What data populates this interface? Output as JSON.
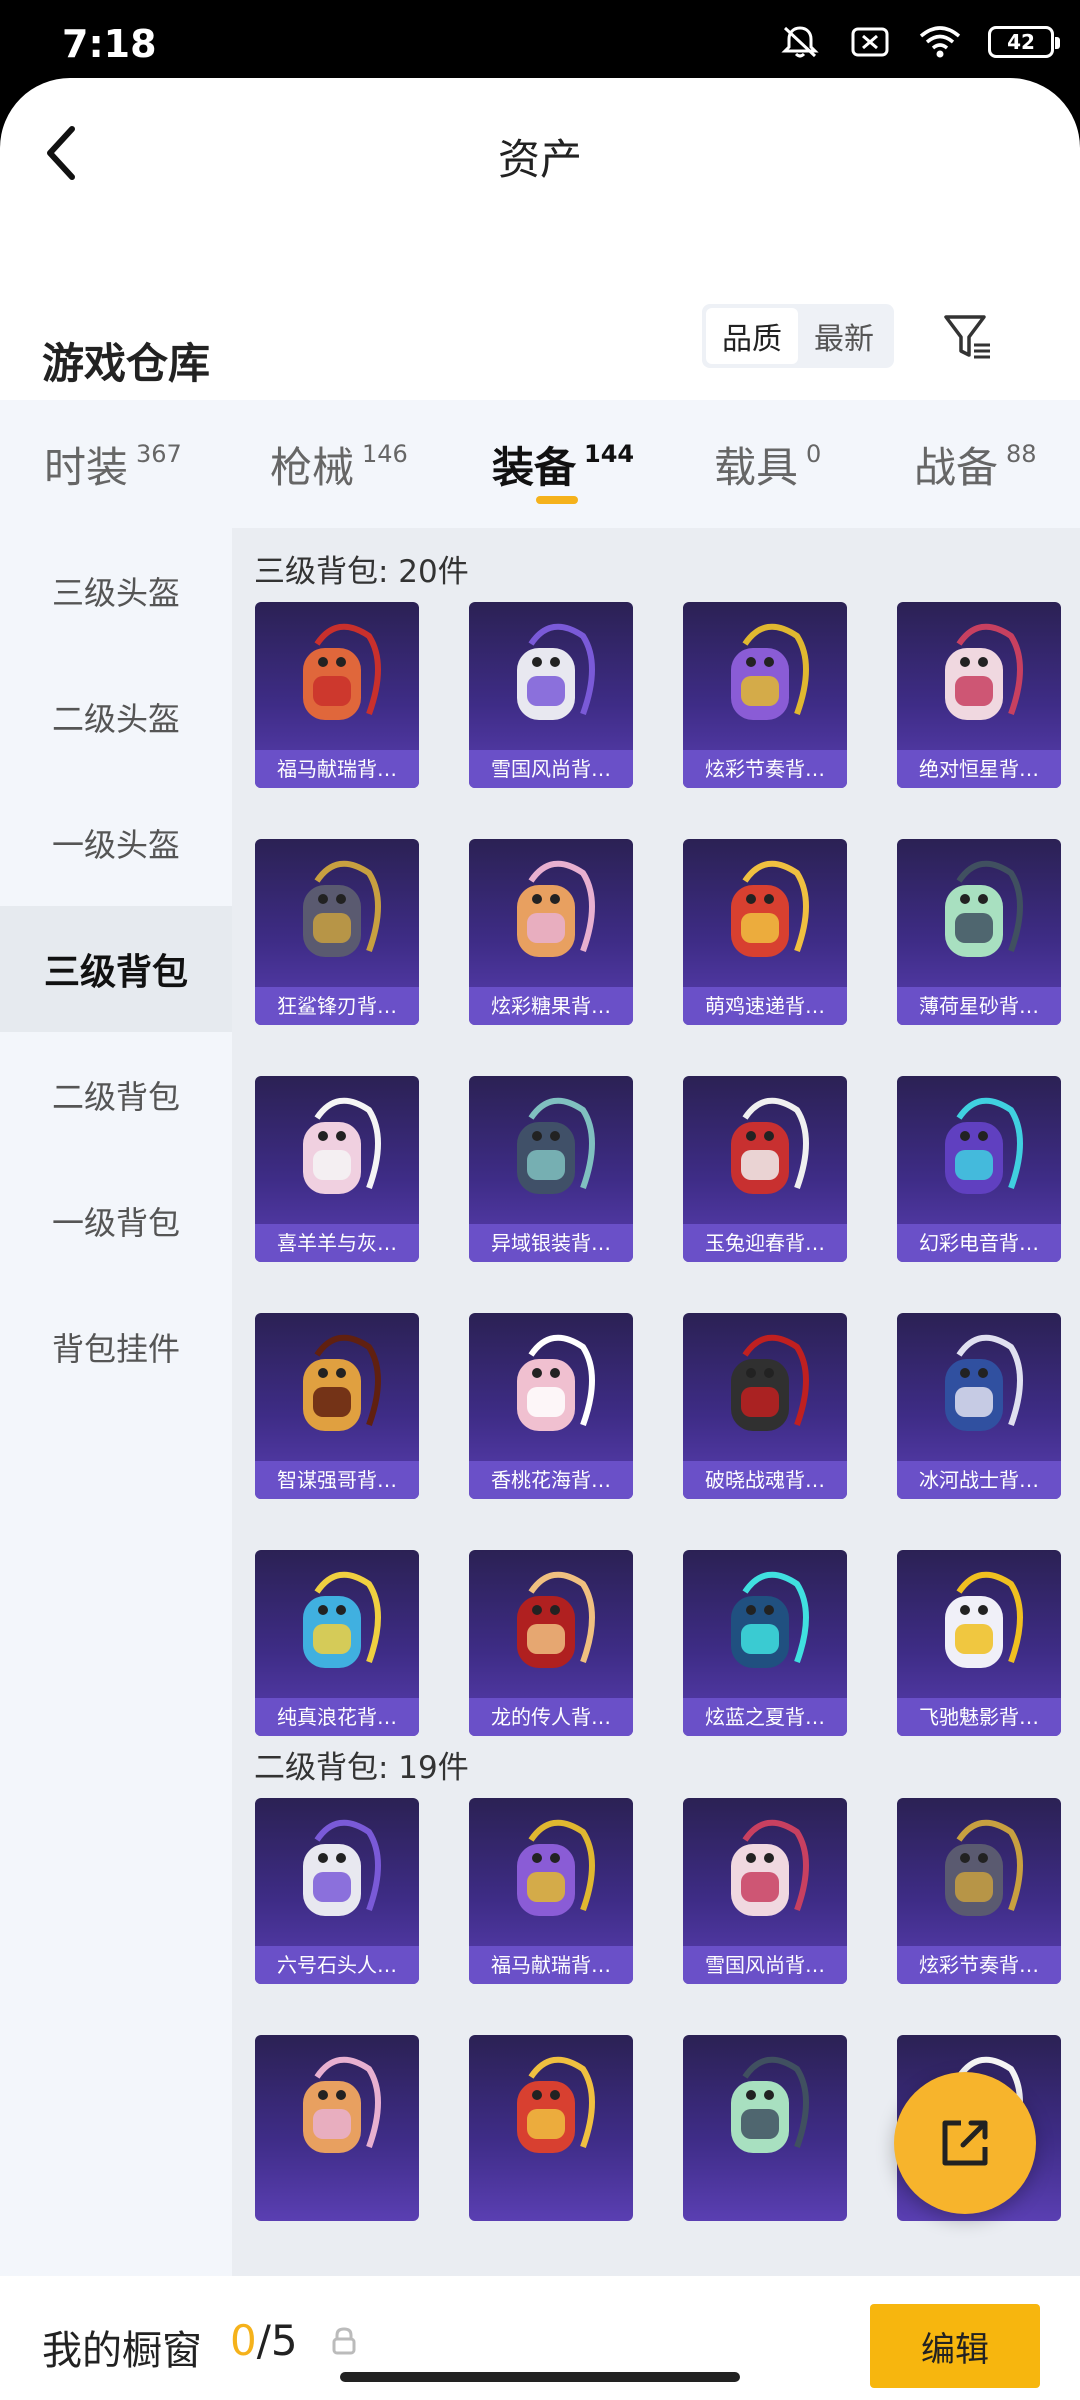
{
  "status": {
    "time": "7:18",
    "battery": "42"
  },
  "header": {
    "title": "资产"
  },
  "section": {
    "title": "游戏仓库",
    "sort_options": [
      "品质",
      "最新"
    ]
  },
  "tabs": [
    {
      "label": "时装",
      "count": "367"
    },
    {
      "label": "枪械",
      "count": "146"
    },
    {
      "label": "装备",
      "count": "144"
    },
    {
      "label": "载具",
      "count": "0"
    },
    {
      "label": "战备",
      "count": "88"
    }
  ],
  "sidebar": {
    "items": [
      "三级头盔",
      "二级头盔",
      "一级头盔",
      "三级背包",
      "二级背包",
      "一级背包",
      "背包挂件"
    ]
  },
  "groups": [
    {
      "title": "三级背包: 20件",
      "items": [
        "福马献瑞背…",
        "雪国风尚背…",
        "炫彩节奏背…",
        "绝对恒星背…",
        "狂鲨锋刃背…",
        "炫彩糖果背…",
        "萌鸡速递背…",
        "薄荷星砂背…",
        "喜羊羊与灰…",
        "异域银装背…",
        "玉兔迎春背…",
        "幻彩电音背…",
        "智谋强哥背…",
        "香桃花海背…",
        "破晓战魂背…",
        "冰河战士背…",
        "纯真浪花背…",
        "龙的传人背…",
        "炫蓝之夏背…",
        "飞驰魅影背…"
      ]
    },
    {
      "title": "二级背包: 19件",
      "items": [
        "六号石头人…",
        "福马献瑞背…",
        "雪国风尚背…",
        "炫彩节奏背…",
        "",
        "",
        "",
        ""
      ]
    }
  ],
  "bottom": {
    "label": "我的橱窗",
    "used": "0",
    "total": "/5",
    "edit_label": "编辑"
  },
  "colors": {
    "accent": "#f5b21b",
    "card_top": "#2b2154",
    "card_caption": "#6a50c8"
  }
}
